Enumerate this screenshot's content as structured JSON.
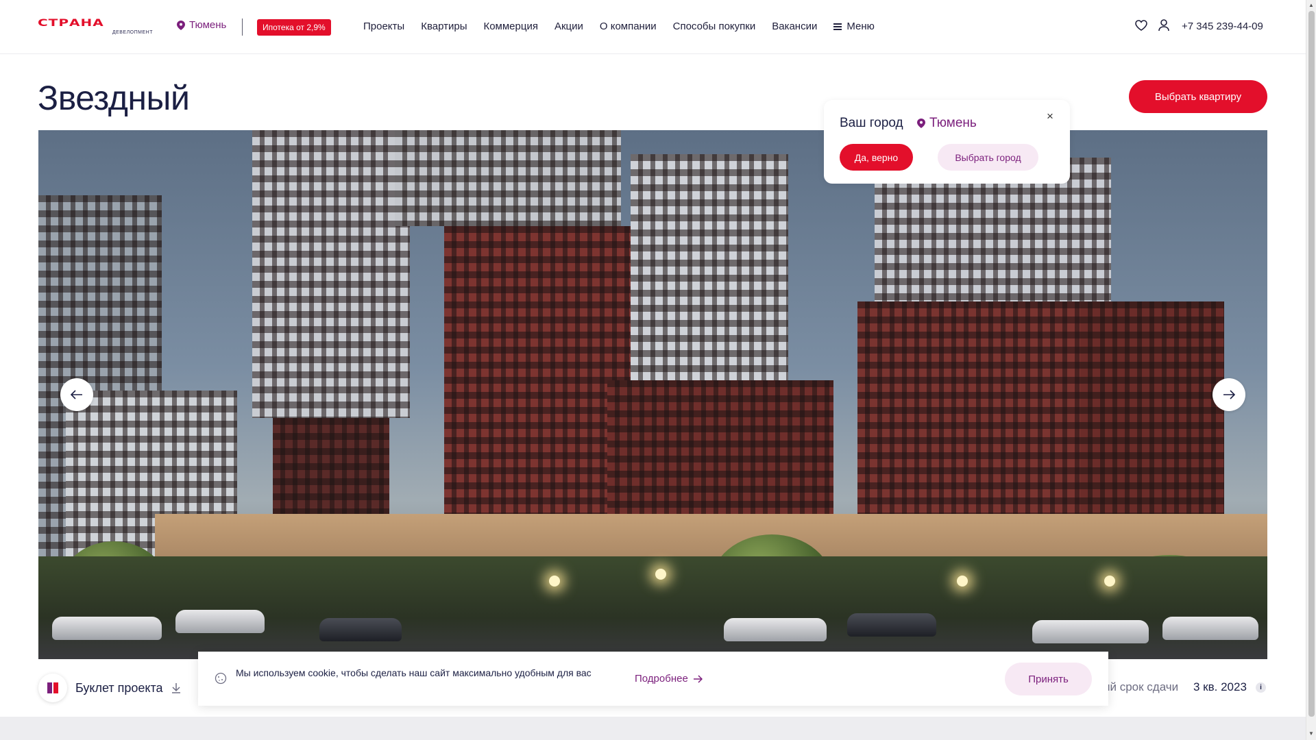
{
  "header": {
    "logo_text": "СТРАНА",
    "logo_sub": "ДЕВЕЛОПМЕНТ",
    "city": "Тюмень",
    "mortgage_badge": "Ипотека от 2,9%",
    "nav": [
      "Проекты",
      "Квартиры",
      "Коммерция",
      "Акции",
      "О компании",
      "Способы покупки",
      "Вакансии"
    ],
    "menu_label": "Меню",
    "phone": "+7 345 239-44-09",
    "icons": [
      "heart-icon",
      "user-icon"
    ]
  },
  "main": {
    "title": "Звездный",
    "choose_apartment": "Выбрать квартиру",
    "booklet_label": "Буклет проекта",
    "deadline_label": "ий срок сдачи",
    "deadline_value": "3 кв. 2023",
    "info_mark": "i"
  },
  "city_popup": {
    "question": "Ваш город",
    "city": "Тюмень",
    "confirm": "Да, верно",
    "choose": "Выбрать город",
    "close": "×"
  },
  "cookie": {
    "text": "Мы используем cookie, чтобы сделать наш сайт максимально удобным для вас",
    "more": "Подробнее",
    "accept": "Принять"
  },
  "colors": {
    "accent_red": "#e30f2b",
    "brand_purple": "#7b1f7c",
    "text_dark": "#1b1f43",
    "soft_pink": "#f7e9f4"
  }
}
